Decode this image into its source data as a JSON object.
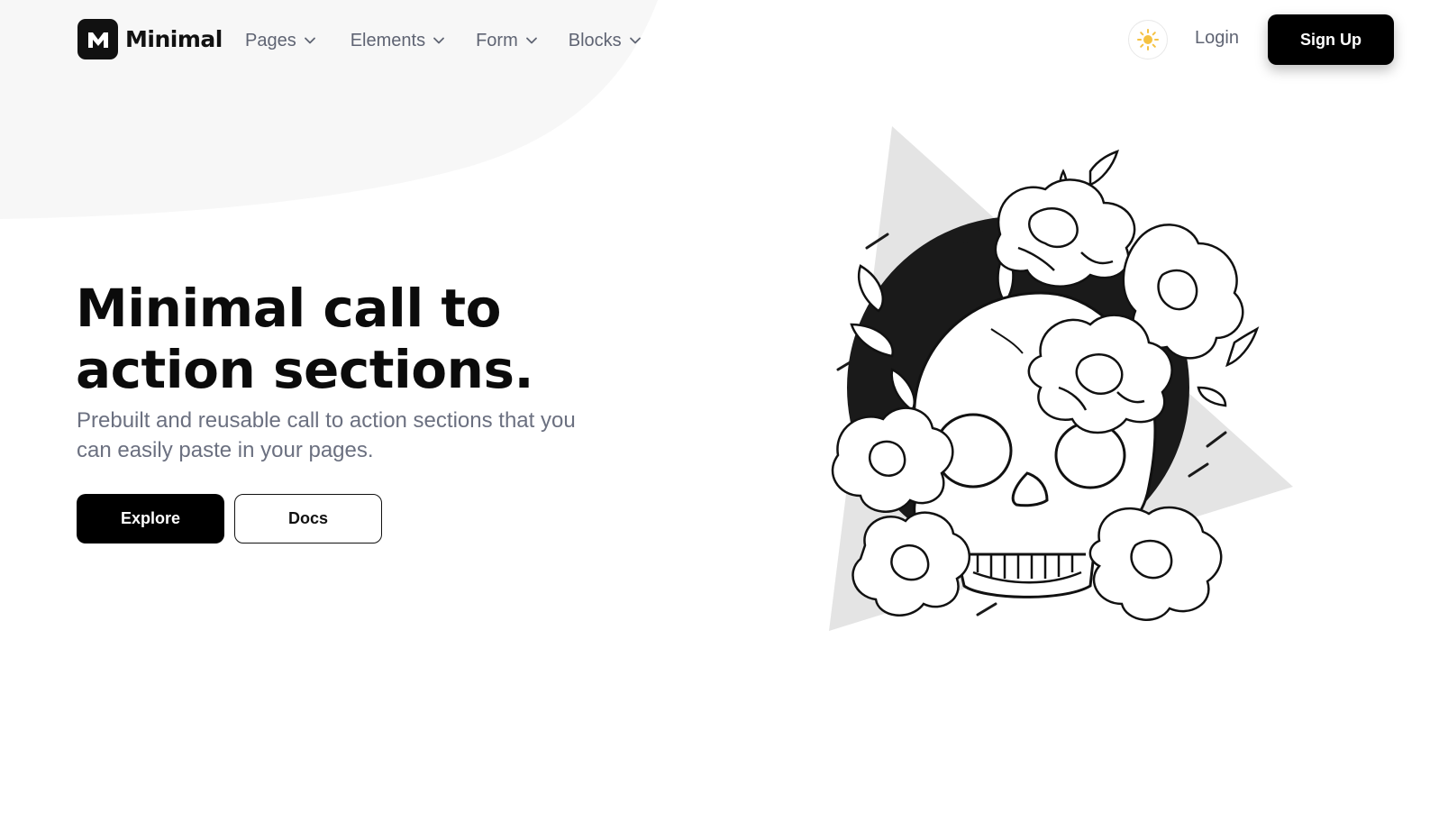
{
  "brand": {
    "name": "Minimal",
    "mark_letter": "M"
  },
  "nav": {
    "items": [
      {
        "label": "Pages"
      },
      {
        "label": "Elements"
      },
      {
        "label": "Form"
      },
      {
        "label": "Blocks"
      }
    ]
  },
  "header": {
    "theme_icon": "sun-icon",
    "login_label": "Login",
    "signup_label": "Sign Up"
  },
  "hero": {
    "title_line1": "Minimal call to",
    "title_line2": "action sections.",
    "subtitle_line1": "Prebuilt and reusable call to action sections that you",
    "subtitle_line2": "can easily paste in your pages.",
    "primary_label": "Explore",
    "secondary_label": "Docs"
  },
  "illustration": {
    "subject": "skull-with-peonies-illustration"
  },
  "colors": {
    "primary": "#000000",
    "text_muted": "#6b7080",
    "accent_sun": "#f5c242",
    "bg_shape": "#f7f7f7",
    "triangle": "#e4e4e4"
  }
}
